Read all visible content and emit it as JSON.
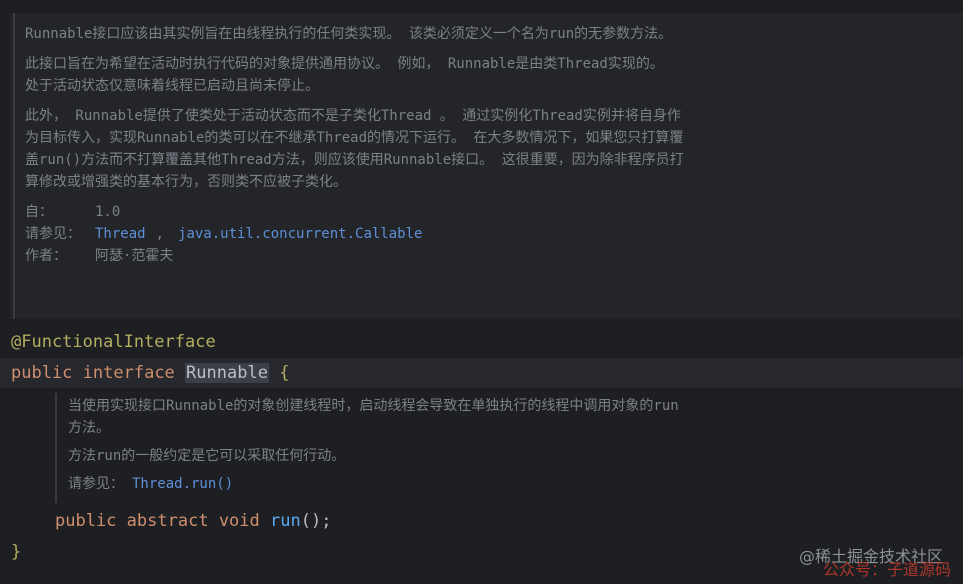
{
  "doc": {
    "p1": "Runnable接口应该由其实例旨在由线程执行的任何类实现。 该类必须定义一个名为run的无参数方法。",
    "p2": "此接口旨在为希望在活动时执行代码的对象提供通用协议。 例如， Runnable是由类Thread实现的。 处于活动状态仅意味着线程已启动且尚未停止。",
    "p3": "此外， Runnable提供了使类处于活动状态而不是子类化Thread 。 通过实例化Thread实例并将自身作为目标传入，实现Runnable的类可以在不继承Thread的情况下运行。 在大多数情况下，如果您只打算覆盖run()方法而不打算覆盖其他Thread方法，则应该使用Runnable接口。 这很重要，因为除非程序员打算修改或增强类的基本行为，否则类不应被子类化。",
    "since_label": "自：",
    "since_value": "1.0",
    "see_label": "请参见：",
    "see_link1": "Thread",
    "see_sep": ",",
    "see_link2": "java.util.concurrent.Callable",
    "author_label": "作者：",
    "author_value": "阿瑟·范霍夫"
  },
  "code": {
    "annotation": "@FunctionalInterface",
    "kw_public": "public",
    "kw_interface": "interface",
    "class_name": "Runnable",
    "open_brace": "{",
    "kw_public2": "public",
    "kw_abstract": "abstract",
    "kw_void": "void",
    "method": "run",
    "method_tail": "();",
    "close_brace": "}"
  },
  "doc2": {
    "p1": "当使用实现接口Runnable的对象创建线程时，启动线程会导致在单独执行的线程中调用对象的run方法。",
    "p2": "方法run的一般约定是它可以采取任何行动。",
    "see_label": "请参见：",
    "see_link": "Thread.run()"
  },
  "watermark": {
    "site": "@稀土掘金技术社区",
    "account": "公众号：子道源码"
  }
}
